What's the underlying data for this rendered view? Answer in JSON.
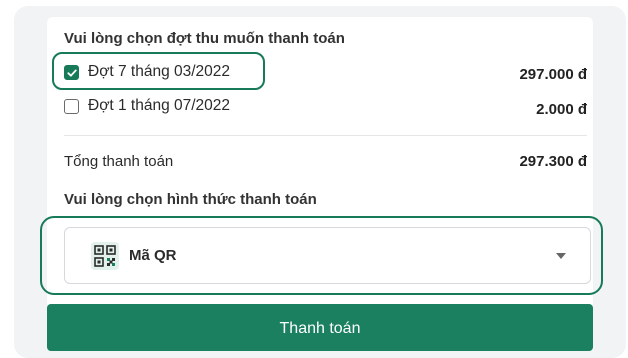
{
  "section_installments": {
    "heading": "Vui lòng chọn đợt thu muốn thanh toán",
    "items": [
      {
        "label": "Đợt 7 tháng 03/2022",
        "amount": "297.000 đ",
        "checked": true
      },
      {
        "label": "Đợt 1 tháng 07/2022",
        "amount": "2.000 đ",
        "checked": false
      }
    ]
  },
  "total": {
    "label": "Tổng thanh toán",
    "amount": "297.300 đ"
  },
  "section_payment_method": {
    "heading": "Vui lòng chọn hình thức thanh toán",
    "selected": "Mã QR",
    "icon": "qr-code-icon"
  },
  "pay_button": {
    "label": "Thanh toán"
  },
  "colors": {
    "accent": "#1a8060",
    "highlight_border": "#177a59",
    "panel_bg": "#f2f3f5"
  }
}
